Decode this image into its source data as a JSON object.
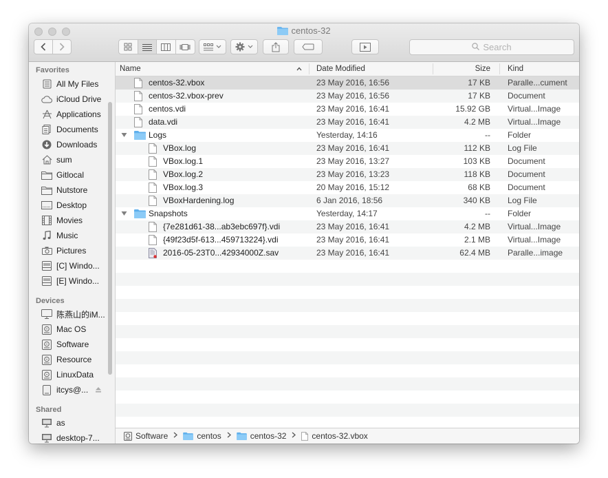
{
  "window": {
    "title": "centos-32"
  },
  "toolbar": {
    "search_placeholder": "Search",
    "back_icon": "chevron-left-icon",
    "forward_icon": "chevron-right-icon"
  },
  "sidebar": {
    "favorites_header": "Favorites",
    "favorites": [
      {
        "label": "All My Files",
        "icon": "all-files-icon"
      },
      {
        "label": "iCloud Drive",
        "icon": "cloud-icon"
      },
      {
        "label": "Applications",
        "icon": "applications-icon"
      },
      {
        "label": "Documents",
        "icon": "documents-icon"
      },
      {
        "label": "Downloads",
        "icon": "download-icon"
      },
      {
        "label": "sum",
        "icon": "home-icon"
      },
      {
        "label": "Gitlocal",
        "icon": "folder-icon"
      },
      {
        "label": "Nutstore",
        "icon": "folder-icon"
      },
      {
        "label": "Desktop",
        "icon": "desktop-icon"
      },
      {
        "label": "Movies",
        "icon": "film-icon"
      },
      {
        "label": "Music",
        "icon": "music-icon"
      },
      {
        "label": "Pictures",
        "icon": "camera-icon"
      },
      {
        "label": "[C] Windo...",
        "icon": "drive-icon"
      },
      {
        "label": "[E] Windo...",
        "icon": "drive-icon"
      }
    ],
    "devices_header": "Devices",
    "devices": [
      {
        "label": "陈燕山的iM...",
        "icon": "imac-icon"
      },
      {
        "label": "Mac OS",
        "icon": "disk-icon"
      },
      {
        "label": "Software",
        "icon": "disk-icon"
      },
      {
        "label": "Resource",
        "icon": "disk-icon"
      },
      {
        "label": "LinuxData",
        "icon": "disk-icon"
      },
      {
        "label": "itcys@...",
        "icon": "external-disk-icon"
      }
    ],
    "shared_header": "Shared",
    "shared": [
      {
        "label": "as",
        "icon": "monitor-icon"
      },
      {
        "label": "desktop-7...",
        "icon": "monitor-icon"
      }
    ]
  },
  "columns": {
    "name": "Name",
    "date": "Date Modified",
    "size": "Size",
    "kind": "Kind"
  },
  "files": [
    {
      "name": "centos-32.vbox",
      "date": "23 May 2016, 16:56",
      "size": "17 KB",
      "kind": "Paralle...cument",
      "type": "doc",
      "indent": 0,
      "selected": true
    },
    {
      "name": "centos-32.vbox-prev",
      "date": "23 May 2016, 16:56",
      "size": "17 KB",
      "kind": "Document",
      "type": "doc",
      "indent": 0
    },
    {
      "name": "centos.vdi",
      "date": "23 May 2016, 16:41",
      "size": "15.92 GB",
      "kind": "Virtual...Image",
      "type": "doc",
      "indent": 0
    },
    {
      "name": "data.vdi",
      "date": "23 May 2016, 16:41",
      "size": "4.2 MB",
      "kind": "Virtual...Image",
      "type": "doc",
      "indent": 0
    },
    {
      "name": "Logs",
      "date": "Yesterday, 14:16",
      "size": "--",
      "kind": "Folder",
      "type": "folder",
      "indent": 0,
      "expanded": true
    },
    {
      "name": "VBox.log",
      "date": "23 May 2016, 16:41",
      "size": "112 KB",
      "kind": "Log File",
      "type": "doc",
      "indent": 1
    },
    {
      "name": "VBox.log.1",
      "date": "23 May 2016, 13:27",
      "size": "103 KB",
      "kind": "Document",
      "type": "doc",
      "indent": 1
    },
    {
      "name": "VBox.log.2",
      "date": "23 May 2016, 13:23",
      "size": "118 KB",
      "kind": "Document",
      "type": "doc",
      "indent": 1
    },
    {
      "name": "VBox.log.3",
      "date": "20 May 2016, 15:12",
      "size": "68 KB",
      "kind": "Document",
      "type": "doc",
      "indent": 1
    },
    {
      "name": "VBoxHardening.log",
      "date": "6 Jan 2016, 18:56",
      "size": "340 KB",
      "kind": "Log File",
      "type": "doc",
      "indent": 1
    },
    {
      "name": "Snapshots",
      "date": "Yesterday, 14:17",
      "size": "--",
      "kind": "Folder",
      "type": "folder",
      "indent": 0,
      "expanded": true
    },
    {
      "name": "{7e281d61-38...ab3ebc697f}.vdi",
      "date": "23 May 2016, 16:41",
      "size": "4.2 MB",
      "kind": "Virtual...Image",
      "type": "doc",
      "indent": 1
    },
    {
      "name": "{49f23d5f-613...459713224}.vdi",
      "date": "23 May 2016, 16:41",
      "size": "2.1 MB",
      "kind": "Virtual...Image",
      "type": "doc",
      "indent": 1
    },
    {
      "name": "2016-05-23T0...42934000Z.sav",
      "date": "23 May 2016, 16:41",
      "size": "62.4 MB",
      "kind": "Paralle...image",
      "type": "sav",
      "indent": 1
    }
  ],
  "path": [
    "Software",
    "centos",
    "centos-32",
    "centos-32.vbox"
  ]
}
